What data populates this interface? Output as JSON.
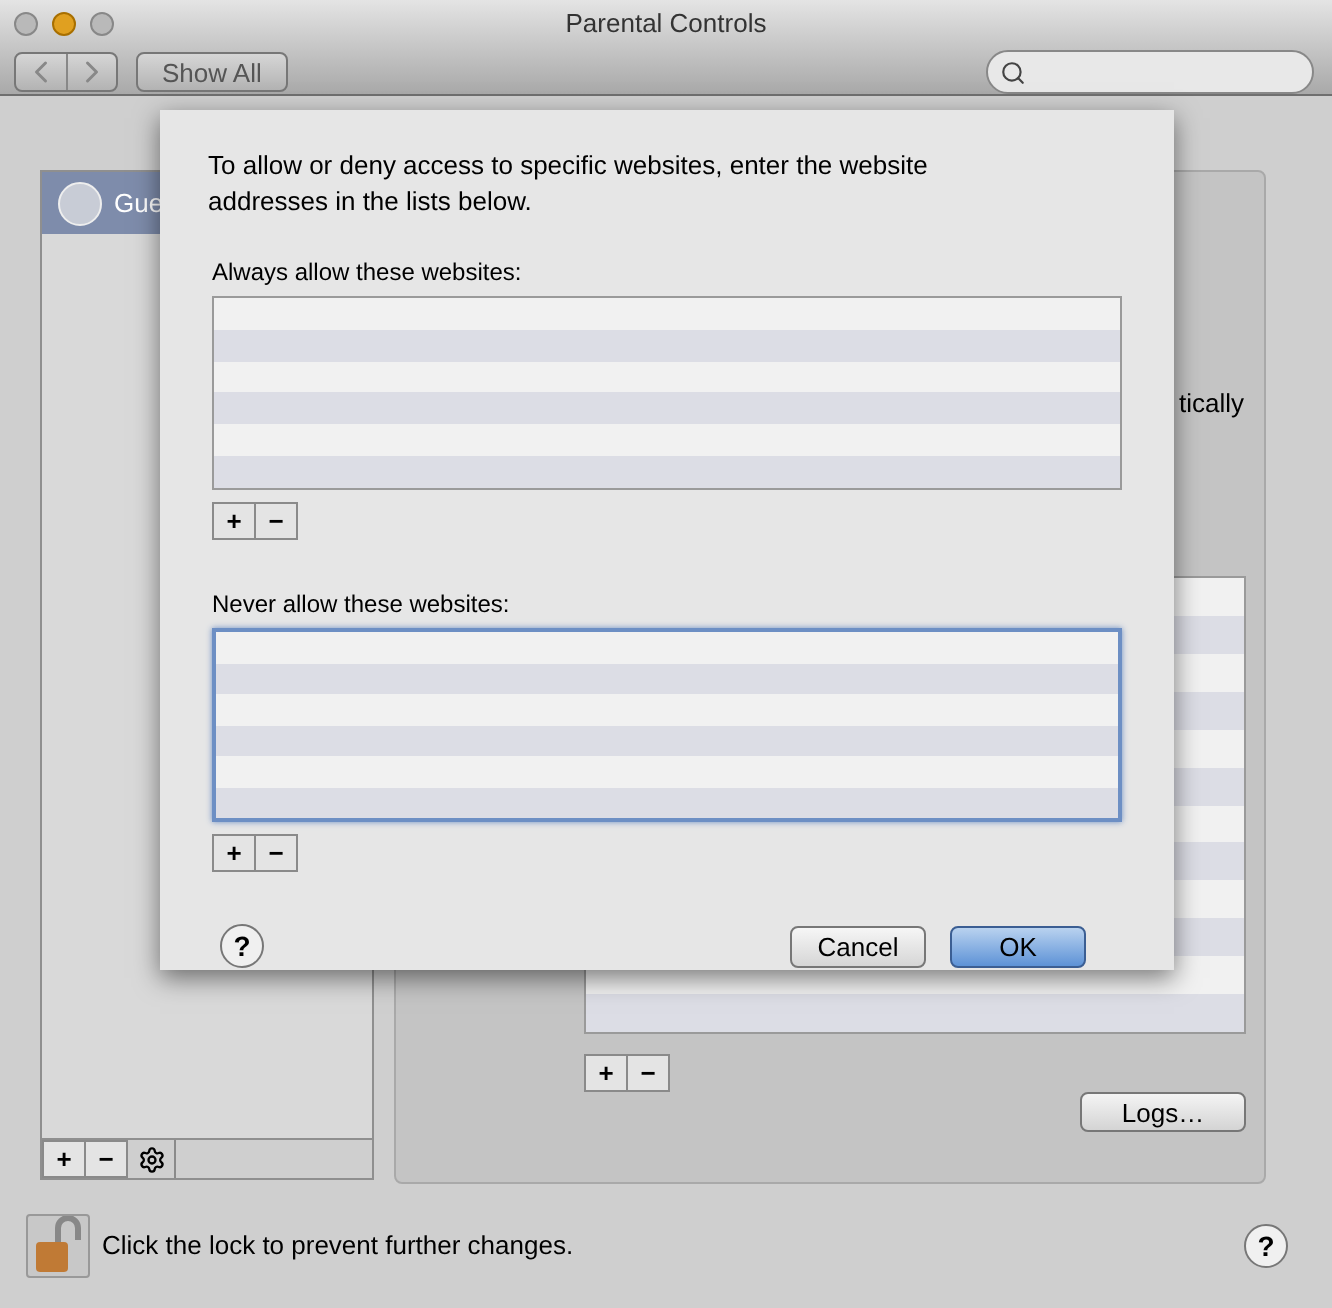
{
  "window": {
    "title": "Parental Controls"
  },
  "toolbar": {
    "show_all": "Show All"
  },
  "sidebar": {
    "items": [
      {
        "label": "Gue",
        "selected": true
      }
    ],
    "buttons": [
      "+",
      "−"
    ]
  },
  "panel": {
    "fragment": "tically",
    "list_buttons": [
      "+",
      "−"
    ],
    "logs": "Logs…"
  },
  "sheet": {
    "message": "To allow or deny access to specific websites, enter the website addresses in the lists below.",
    "lists": [
      {
        "label": "Always allow these websites:",
        "focused": false,
        "buttons": [
          "+",
          "−"
        ]
      },
      {
        "label": "Never allow these websites:",
        "focused": true,
        "buttons": [
          "+",
          "−"
        ]
      }
    ],
    "help": "?",
    "buttons": [
      {
        "label": "Cancel",
        "default": false
      },
      {
        "label": "OK",
        "default": true
      }
    ]
  },
  "lock": {
    "text": "Click the lock to prevent further changes.",
    "help": "?"
  }
}
